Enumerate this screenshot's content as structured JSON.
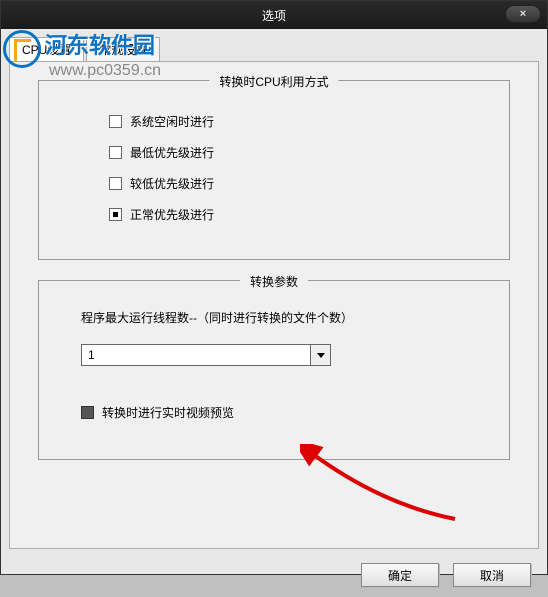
{
  "window": {
    "title": "选项",
    "close": "×"
  },
  "watermark": {
    "name": "河东软件园",
    "url": "www.pc0359.cn"
  },
  "tabs": [
    {
      "label": "CPU设置",
      "active": true
    },
    {
      "label": "常规设置",
      "active": false
    }
  ],
  "cpu_group": {
    "legend": "转换时CPU利用方式",
    "options": [
      {
        "label": "系统空闲时进行",
        "checked": false
      },
      {
        "label": "最低优先级进行",
        "checked": false
      },
      {
        "label": "较低优先级进行",
        "checked": false
      },
      {
        "label": "正常优先级进行",
        "checked": true
      }
    ]
  },
  "param_group": {
    "legend": "转换参数",
    "desc": "程序最大运行线程数--（同时进行转换的文件个数）",
    "thread_value": "1",
    "preview_label": "转换时进行实时视频预览",
    "preview_checked": false
  },
  "buttons": {
    "ok": "确定",
    "cancel": "取消"
  }
}
